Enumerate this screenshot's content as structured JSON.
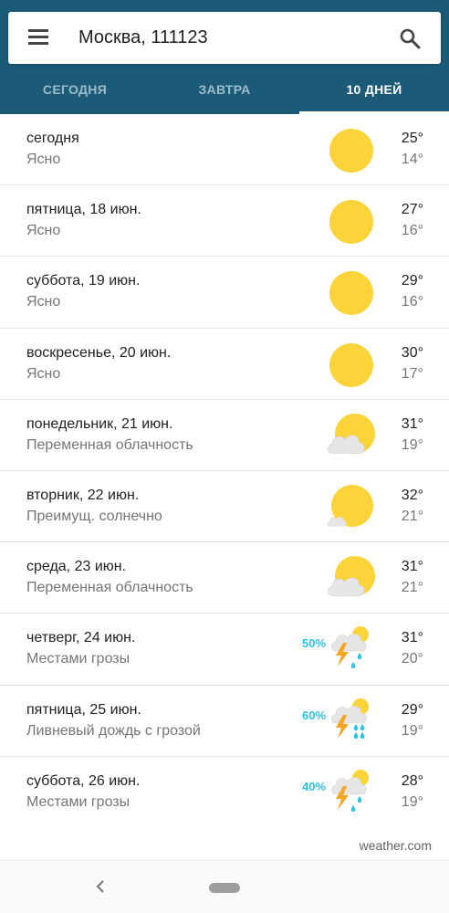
{
  "search": {
    "location": "Москва, 111123"
  },
  "icons": {
    "menu": "menu-icon",
    "search": "search-icon",
    "back": "back-icon"
  },
  "colors": {
    "header": "#1b5b77",
    "precip": "#29c5e6",
    "sun": "#fdd33a",
    "cloud": "#e6e6e6",
    "bolt": "#f5a623"
  },
  "tabs": [
    {
      "label": "СЕГОДНЯ",
      "active": false
    },
    {
      "label": "ЗАВТРА",
      "active": false
    },
    {
      "label": "10 ДНЕЙ",
      "active": true
    }
  ],
  "forecast": [
    {
      "day": "сегодня",
      "condition": "Ясно",
      "high": "25°",
      "low": "14°",
      "icon": "sunny",
      "precip": ""
    },
    {
      "day": "пятница, 18 июн.",
      "condition": "Ясно",
      "high": "27°",
      "low": "16°",
      "icon": "sunny",
      "precip": ""
    },
    {
      "day": "суббота, 19 июн.",
      "condition": "Ясно",
      "high": "29°",
      "low": "16°",
      "icon": "sunny",
      "precip": ""
    },
    {
      "day": "воскресенье, 20 июн.",
      "condition": "Ясно",
      "high": "30°",
      "low": "17°",
      "icon": "sunny",
      "precip": ""
    },
    {
      "day": "понедельник, 21 июн.",
      "condition": "Переменная облачность",
      "high": "31°",
      "low": "19°",
      "icon": "partly-cloudy",
      "precip": ""
    },
    {
      "day": "вторник, 22 июн.",
      "condition": "Преимущ. солнечно",
      "high": "32°",
      "low": "21°",
      "icon": "mostly-sunny",
      "precip": ""
    },
    {
      "day": "среда, 23 июн.",
      "condition": "Переменная облачность",
      "high": "31°",
      "low": "21°",
      "icon": "partly-cloudy",
      "precip": ""
    },
    {
      "day": "четверг, 24 июн.",
      "condition": "Местами грозы",
      "high": "31°",
      "low": "20°",
      "icon": "thunderstorm",
      "precip": "50%"
    },
    {
      "day": "пятница, 25 июн.",
      "condition": "Ливневый дождь с грозой",
      "high": "29°",
      "low": "19°",
      "icon": "thunder-shower",
      "precip": "60%"
    },
    {
      "day": "суббота, 26 июн.",
      "condition": "Местами грозы",
      "high": "28°",
      "low": "19°",
      "icon": "thunderstorm",
      "precip": "40%"
    }
  ],
  "attribution": "weather.com"
}
